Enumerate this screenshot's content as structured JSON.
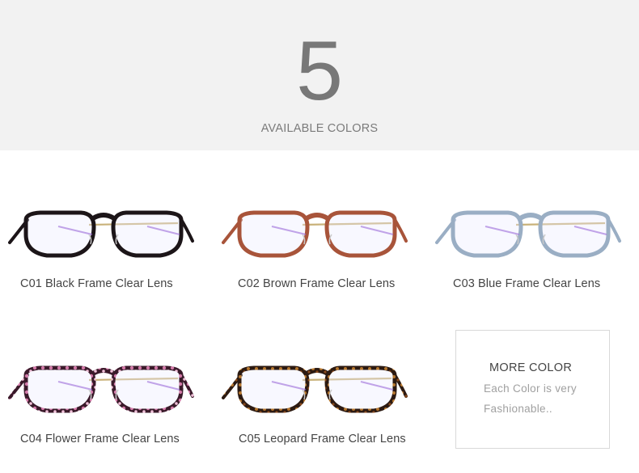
{
  "header": {
    "count": "5",
    "label": "AVAILABLE COLORS"
  },
  "products": [
    {
      "code": "C01",
      "caption": "C01 Black Frame Clear Lens",
      "frame_color": "#1c1518",
      "temple_color": "#c9b27a",
      "pattern": "solid"
    },
    {
      "code": "C02",
      "caption": "C02 Brown Frame Clear Lens",
      "frame_color": "#a8543a",
      "temple_color": "#c9b27a",
      "pattern": "solid"
    },
    {
      "code": "C03",
      "caption": "C03 Blue Frame Clear Lens",
      "frame_color": "#9aaec4",
      "temple_color": "#c9b27a",
      "pattern": "solid"
    },
    {
      "code": "C04",
      "caption": "C04 Flower Frame Clear Lens",
      "frame_color": "#3a1a2a",
      "temple_color": "#c9b27a",
      "pattern": "floral"
    },
    {
      "code": "C05",
      "caption": "C05 Leopard Frame Clear Lens",
      "frame_color": "#2c1a12",
      "temple_color": "#c9b27a",
      "pattern": "leopard"
    }
  ],
  "more_color": {
    "title": "MORE COLOR",
    "line1": "Each Color is very",
    "line2": "Fashionable.."
  }
}
